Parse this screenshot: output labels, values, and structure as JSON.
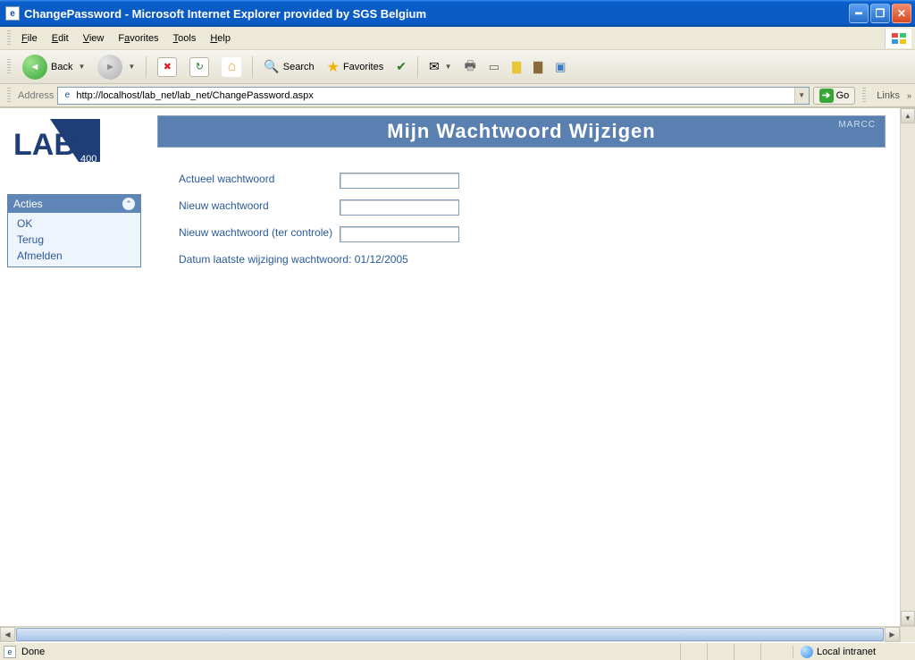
{
  "window": {
    "title": "ChangePassword - Microsoft Internet Explorer provided by SGS Belgium"
  },
  "menu": {
    "items": [
      "File",
      "Edit",
      "View",
      "Favorites",
      "Tools",
      "Help"
    ]
  },
  "toolbar": {
    "back": "Back",
    "search": "Search",
    "favorites": "Favorites"
  },
  "addressbar": {
    "label": "Address",
    "url": "http://localhost/lab_net/lab_net/ChangePassword.aspx",
    "go": "Go",
    "links": "Links"
  },
  "logo": {
    "text_main": "LAB",
    "text_sub": "400"
  },
  "sidebar": {
    "header": "Acties",
    "items": [
      "OK",
      "Terug",
      "Afmelden"
    ]
  },
  "header_band": {
    "title": "Mijn Wachtwoord Wijzigen",
    "user": "MARCC"
  },
  "form": {
    "rows": [
      {
        "label": "Actueel wachtwoord",
        "value": ""
      },
      {
        "label": "Nieuw wachtwoord",
        "value": ""
      },
      {
        "label": "Nieuw wachtwoord (ter controle)",
        "value": ""
      }
    ],
    "note_prefix": "Datum laatste wijziging wachtwoord: ",
    "note_date": "01/12/2005"
  },
  "statusbar": {
    "status": "Done",
    "zone": "Local intranet"
  }
}
